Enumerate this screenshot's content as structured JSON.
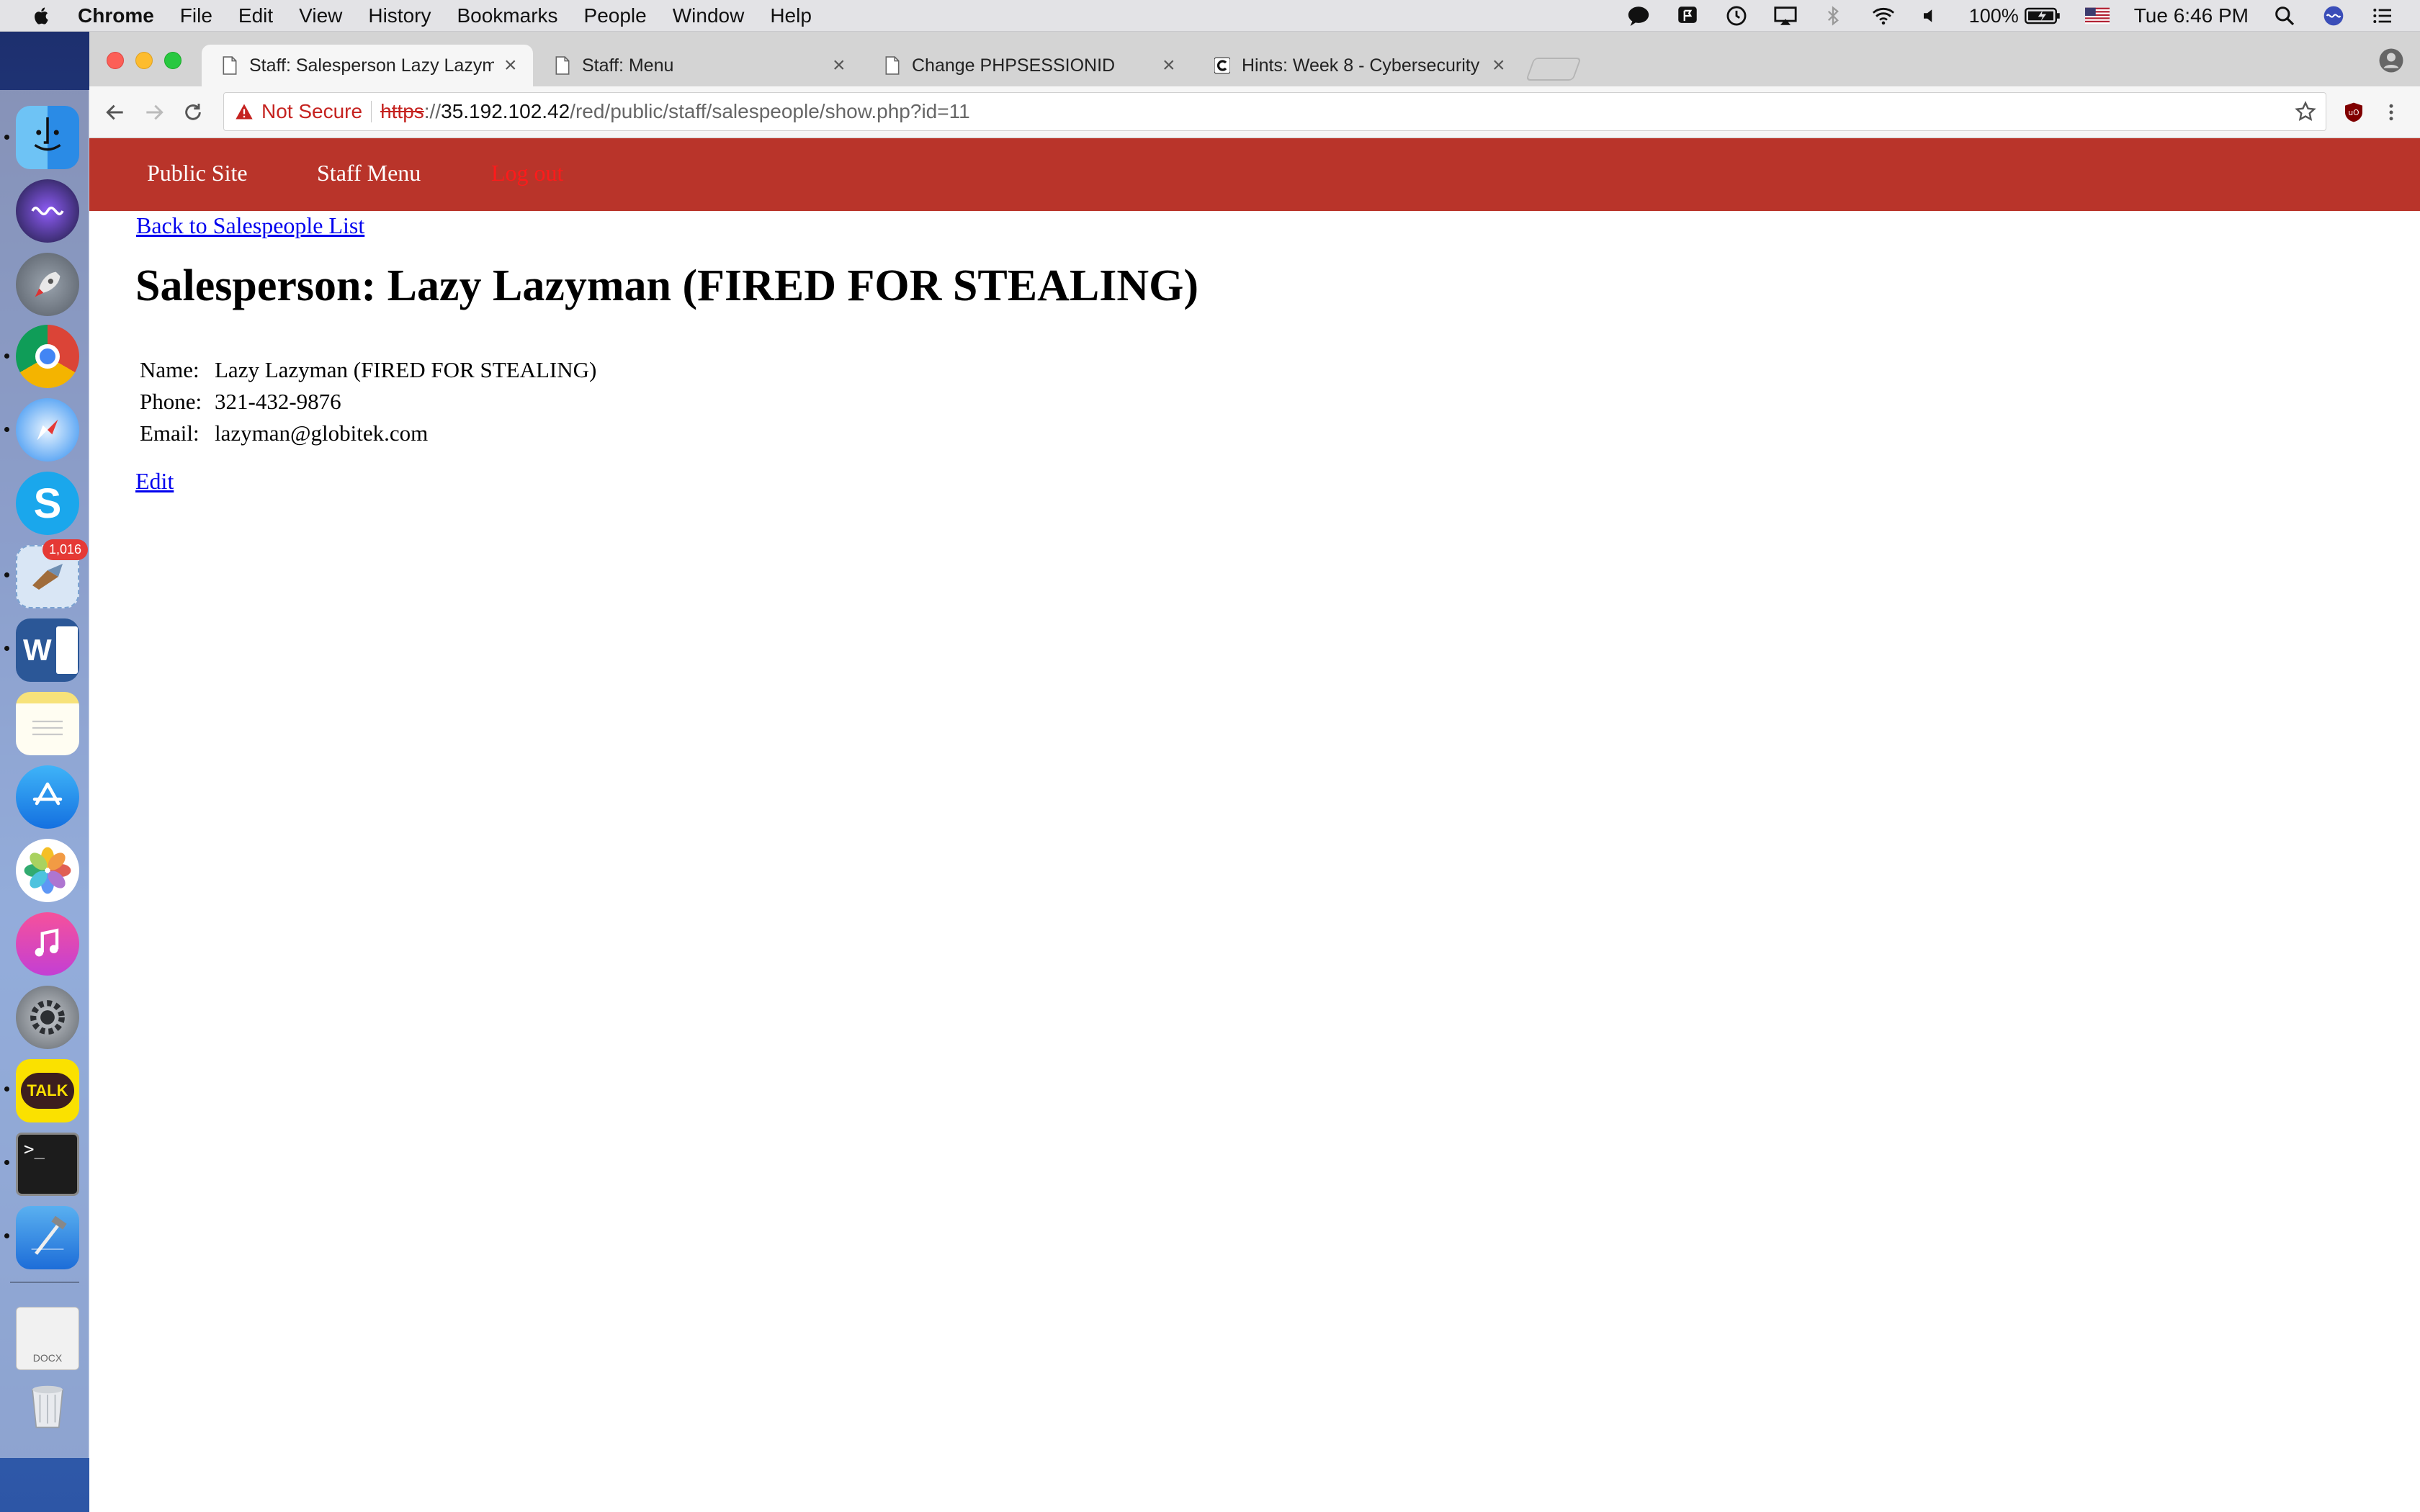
{
  "menubar": {
    "app_name": "Chrome",
    "items": [
      "File",
      "Edit",
      "View",
      "History",
      "Bookmarks",
      "People",
      "Window",
      "Help"
    ],
    "battery": "100%",
    "clock": "Tue 6:46 PM"
  },
  "dock": {
    "apps": [
      {
        "name": "Finder",
        "icon": "finder-icon"
      },
      {
        "name": "Siri",
        "icon": "siri-icon"
      },
      {
        "name": "Launchpad",
        "icon": "rocket-icon"
      },
      {
        "name": "Chrome",
        "icon": "chrome-icon"
      },
      {
        "name": "Safari",
        "icon": "compass-icon"
      },
      {
        "name": "Skype",
        "icon": "skype-icon"
      },
      {
        "name": "Mail",
        "icon": "mail-icon",
        "badge": "1,016"
      },
      {
        "name": "Word",
        "icon": "word-icon"
      },
      {
        "name": "Notes",
        "icon": "notes-icon"
      },
      {
        "name": "App Store",
        "icon": "app-store-icon"
      },
      {
        "name": "Photos",
        "icon": "photos-icon"
      },
      {
        "name": "iTunes",
        "icon": "music-icon"
      },
      {
        "name": "System Preferences",
        "icon": "gear-icon"
      },
      {
        "name": "KakaoTalk",
        "icon": "talk-icon",
        "label": "TALK"
      },
      {
        "name": "Terminal",
        "icon": "terminal-icon"
      },
      {
        "name": "Xcode",
        "icon": "hammer-icon"
      },
      {
        "name": "Documents",
        "icon": "document-stack-icon",
        "label": "DOCX"
      },
      {
        "name": "Trash",
        "icon": "trash-icon"
      }
    ]
  },
  "browser": {
    "tabs": [
      {
        "title": "Staff: Salesperson Lazy Lazym",
        "active": true
      },
      {
        "title": "Staff: Menu",
        "active": false
      },
      {
        "title": "Change PHPSESSIONID",
        "active": false
      },
      {
        "title": "Hints: Week 8 - Cybersecurity",
        "active": false
      }
    ],
    "address": {
      "security_label": "Not Secure",
      "scheme": "https",
      "scheme_sep": "://",
      "host": "35.192.102.42",
      "path": "/red/public/staff/salespeople/show.php?id=11"
    }
  },
  "page": {
    "nav": {
      "public_site": "Public Site",
      "staff_menu": "Staff Menu",
      "logout": "Log out"
    },
    "back_link": "Back to Salespeople List",
    "heading": "Salesperson: Lazy Lazyman (FIRED FOR STEALING)",
    "attributes": [
      {
        "label": "Name:",
        "value": "Lazy Lazyman (FIRED FOR STEALING)"
      },
      {
        "label": "Phone:",
        "value": "321-432-9876"
      },
      {
        "label": "Email:",
        "value": "lazyman@globitek.com"
      }
    ],
    "edit_link": "Edit"
  },
  "colors": {
    "nav_bar": "#b9342a",
    "link": "#0000ee",
    "logout": "#ff1a1a",
    "not_secure": "#c5221f"
  }
}
